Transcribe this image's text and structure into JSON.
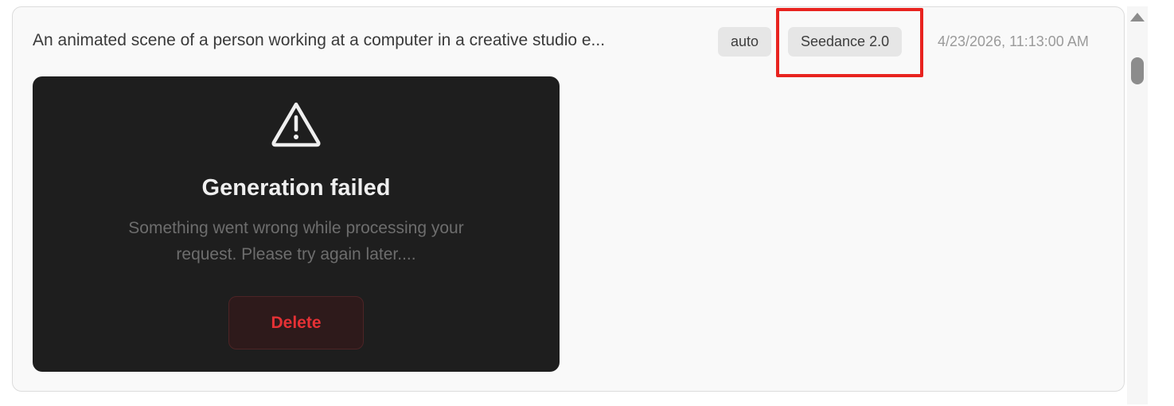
{
  "item": {
    "prompt": "An animated scene of a person working at a computer in a creative studio e...",
    "tags": {
      "aspect": "auto",
      "model": "Seedance 2.0"
    },
    "timestamp": "4/23/2026, 11:13:00 AM"
  },
  "error": {
    "icon": "warning-triangle-icon",
    "title": "Generation failed",
    "message": "Something went wrong while processing your request. Please try again later....",
    "delete_label": "Delete"
  },
  "colors": {
    "highlight": "#e8231f",
    "error_panel_bg": "#1e1e1e",
    "delete_text": "#e53135"
  }
}
